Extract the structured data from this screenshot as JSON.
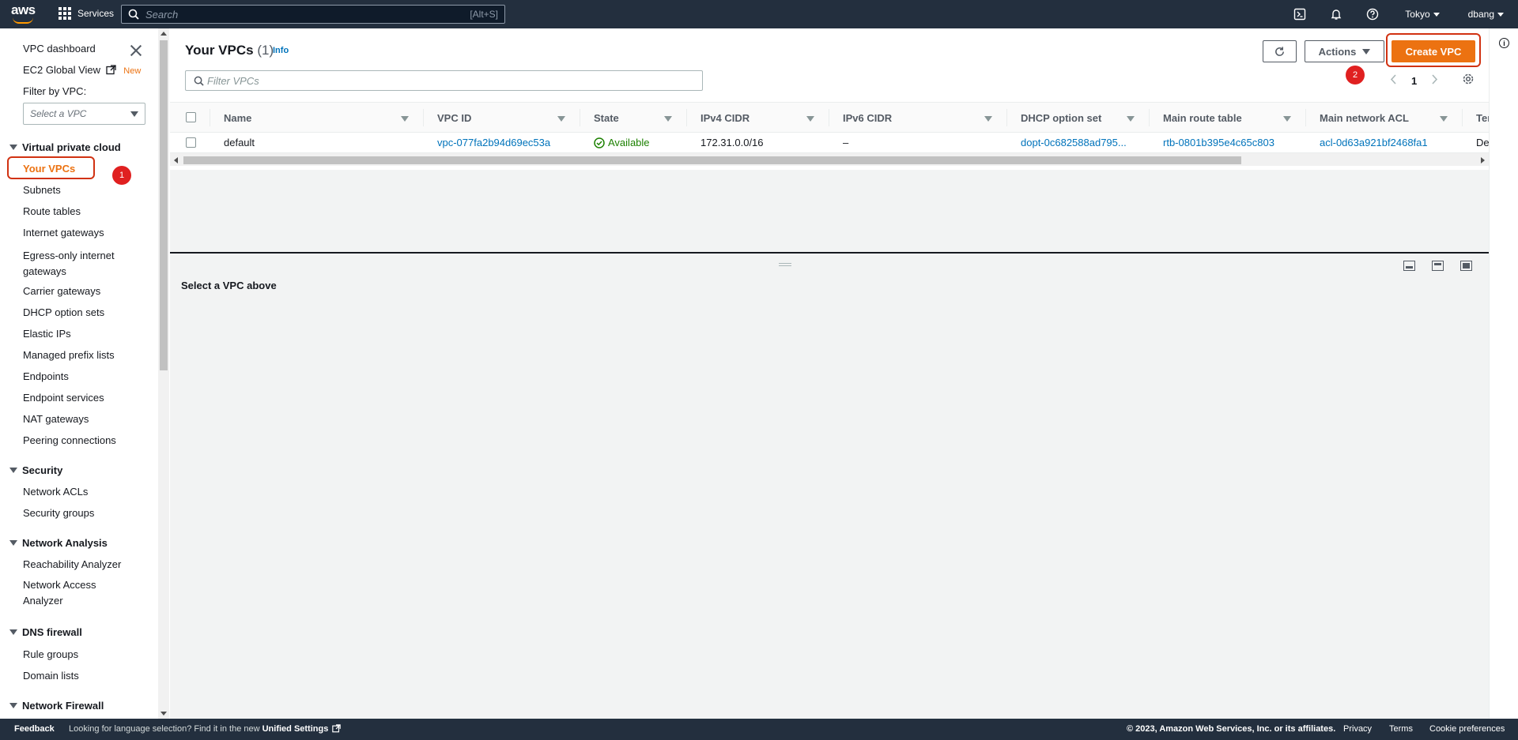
{
  "topnav": {
    "logo": "aws",
    "services_label": "Services",
    "search_placeholder": "Search",
    "search_shortcut": "[Alt+S]",
    "region": "Tokyo",
    "user": "dbang",
    "icons": [
      "cloudshell-icon",
      "bell-icon",
      "help-icon"
    ]
  },
  "sidebar": {
    "dashboard": "VPC dashboard",
    "global_view": "EC2 Global View",
    "new_badge": "New",
    "filter_label": "Filter by VPC:",
    "select_placeholder": "Select a VPC",
    "sections": [
      {
        "title": "Virtual private cloud",
        "items": [
          "Your VPCs",
          "Subnets",
          "Route tables",
          "Internet gateways",
          "Egress-only internet gateways",
          "Carrier gateways",
          "DHCP option sets",
          "Elastic IPs",
          "Managed prefix lists",
          "Endpoints",
          "Endpoint services",
          "NAT gateways",
          "Peering connections"
        ]
      },
      {
        "title": "Security",
        "items": [
          "Network ACLs",
          "Security groups"
        ]
      },
      {
        "title": "Network Analysis",
        "items": [
          "Reachability Analyzer",
          "Network Access Analyzer"
        ]
      },
      {
        "title": "DNS firewall",
        "items": [
          "Rule groups",
          "Domain lists"
        ]
      },
      {
        "title": "Network Firewall",
        "items": []
      }
    ],
    "active_item": "Your VPCs",
    "egress_line1": "Egress-only internet",
    "egress_line2": "gateways",
    "naa_line1": "Network Access",
    "naa_line2": "Analyzer"
  },
  "annotations": {
    "badge1": "1",
    "badge2": "2",
    "highlight_color": "#d13212"
  },
  "main": {
    "title": "Your VPCs",
    "count": "(1)",
    "info": "Info",
    "actions_label": "Actions",
    "create_label": "Create VPC",
    "filter_placeholder": "Filter VPCs",
    "page": "1",
    "columns": [
      "Name",
      "VPC ID",
      "State",
      "IPv4 CIDR",
      "IPv6 CIDR",
      "DHCP option set",
      "Main route table",
      "Main network ACL",
      "Ten"
    ],
    "rows": [
      {
        "name": "default",
        "vpc_id": "vpc-077fa2b94d69ec53a",
        "state": "Available",
        "ipv4": "172.31.0.0/16",
        "ipv6": "–",
        "dhcp": "dopt-0c682588ad795...",
        "route_table": "rtb-0801b395e4c65c803",
        "acl": "acl-0d63a921bf2468fa1",
        "tenancy": "Def"
      }
    ],
    "detail_hint": "Select a VPC above"
  },
  "footer": {
    "feedback": "Feedback",
    "lang_prefix": "Looking for language selection? Find it in the new ",
    "lang_link": "Unified Settings",
    "copyright": "© 2023, Amazon Web Services, Inc. or its affiliates.",
    "privacy": "Privacy",
    "terms": "Terms",
    "cookies": "Cookie preferences"
  },
  "colors": {
    "nav_bg": "#232f3e",
    "accent": "#ec7211",
    "link": "#0073bb",
    "success": "#1d8102"
  }
}
